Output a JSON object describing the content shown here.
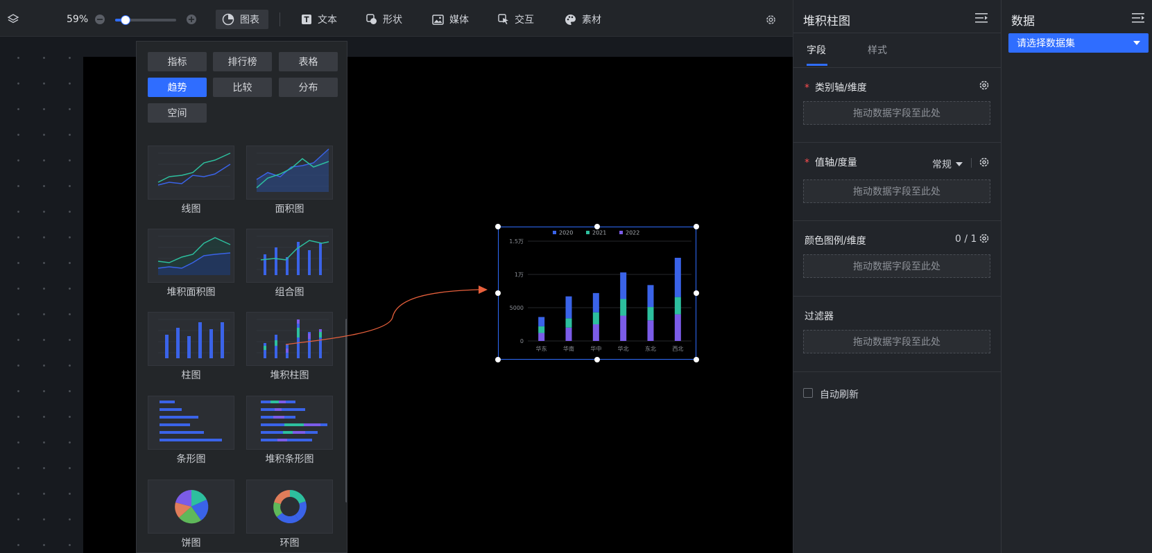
{
  "toolbar": {
    "zoom": "59%",
    "zoom_level": 0.59,
    "items": [
      {
        "label": "图表",
        "icon": "pie-chart-icon"
      },
      {
        "label": "文本",
        "icon": "text-icon"
      },
      {
        "label": "形状",
        "icon": "shape-icon"
      },
      {
        "label": "媒体",
        "icon": "image-icon"
      },
      {
        "label": "交互",
        "icon": "pointer-icon"
      },
      {
        "label": "素材",
        "icon": "palette-icon"
      }
    ]
  },
  "chart_picker": {
    "categories": [
      {
        "label": "指标",
        "active": false
      },
      {
        "label": "排行榜",
        "active": false
      },
      {
        "label": "表格",
        "active": false
      },
      {
        "label": "趋势",
        "active": true
      },
      {
        "label": "比较",
        "active": false
      },
      {
        "label": "分布",
        "active": false
      },
      {
        "label": "空间",
        "active": false
      }
    ],
    "charts": [
      "线图",
      "面积图",
      "堆积面积图",
      "组合图",
      "柱图",
      "堆积柱图",
      "条形图",
      "堆积条形图",
      "饼图",
      "环图"
    ]
  },
  "chart_data": {
    "type": "bar",
    "stacked": true,
    "categories": [
      "华东",
      "华南",
      "华中",
      "华北",
      "东北",
      "西北"
    ],
    "series": [
      {
        "name": "2020",
        "color": "#3a63e8",
        "values": [
          1400,
          3300,
          2900,
          4000,
          3300,
          5900
        ]
      },
      {
        "name": "2021",
        "color": "#2dbf9e",
        "values": [
          1000,
          1400,
          1800,
          2500,
          2000,
          2600
        ]
      },
      {
        "name": "2022",
        "color": "#7b5ce8",
        "values": [
          1200,
          2000,
          2500,
          3800,
          3100,
          4000
        ]
      }
    ],
    "yticks": [
      "0",
      "5000",
      "1万",
      "1.5万"
    ],
    "ylim": [
      0,
      15000
    ],
    "legend": "top-center",
    "grid": true
  },
  "props": {
    "title": "堆积柱图",
    "tabs": [
      {
        "label": "字段",
        "active": true
      },
      {
        "label": "样式",
        "active": false
      }
    ],
    "sections": {
      "category_axis": {
        "title": "类别轴/维度",
        "required": "*",
        "drop": "拖动数据字段至此处"
      },
      "value_axis": {
        "title": "值轴/度量",
        "required": "*",
        "mode": "常规",
        "drop": "拖动数据字段至此处"
      },
      "color_legend": {
        "title": "颜色图例/维度",
        "count": "0 / 1",
        "drop": "拖动数据字段至此处"
      },
      "filter": {
        "title": "过滤器",
        "drop": "拖动数据字段至此处"
      }
    },
    "auto_refresh": "自动刷新"
  },
  "data_panel": {
    "title": "数据",
    "dataset_select": "请选择数据集"
  },
  "colors": {
    "accent": "#2f6dff",
    "arrow": "#e8603c"
  }
}
